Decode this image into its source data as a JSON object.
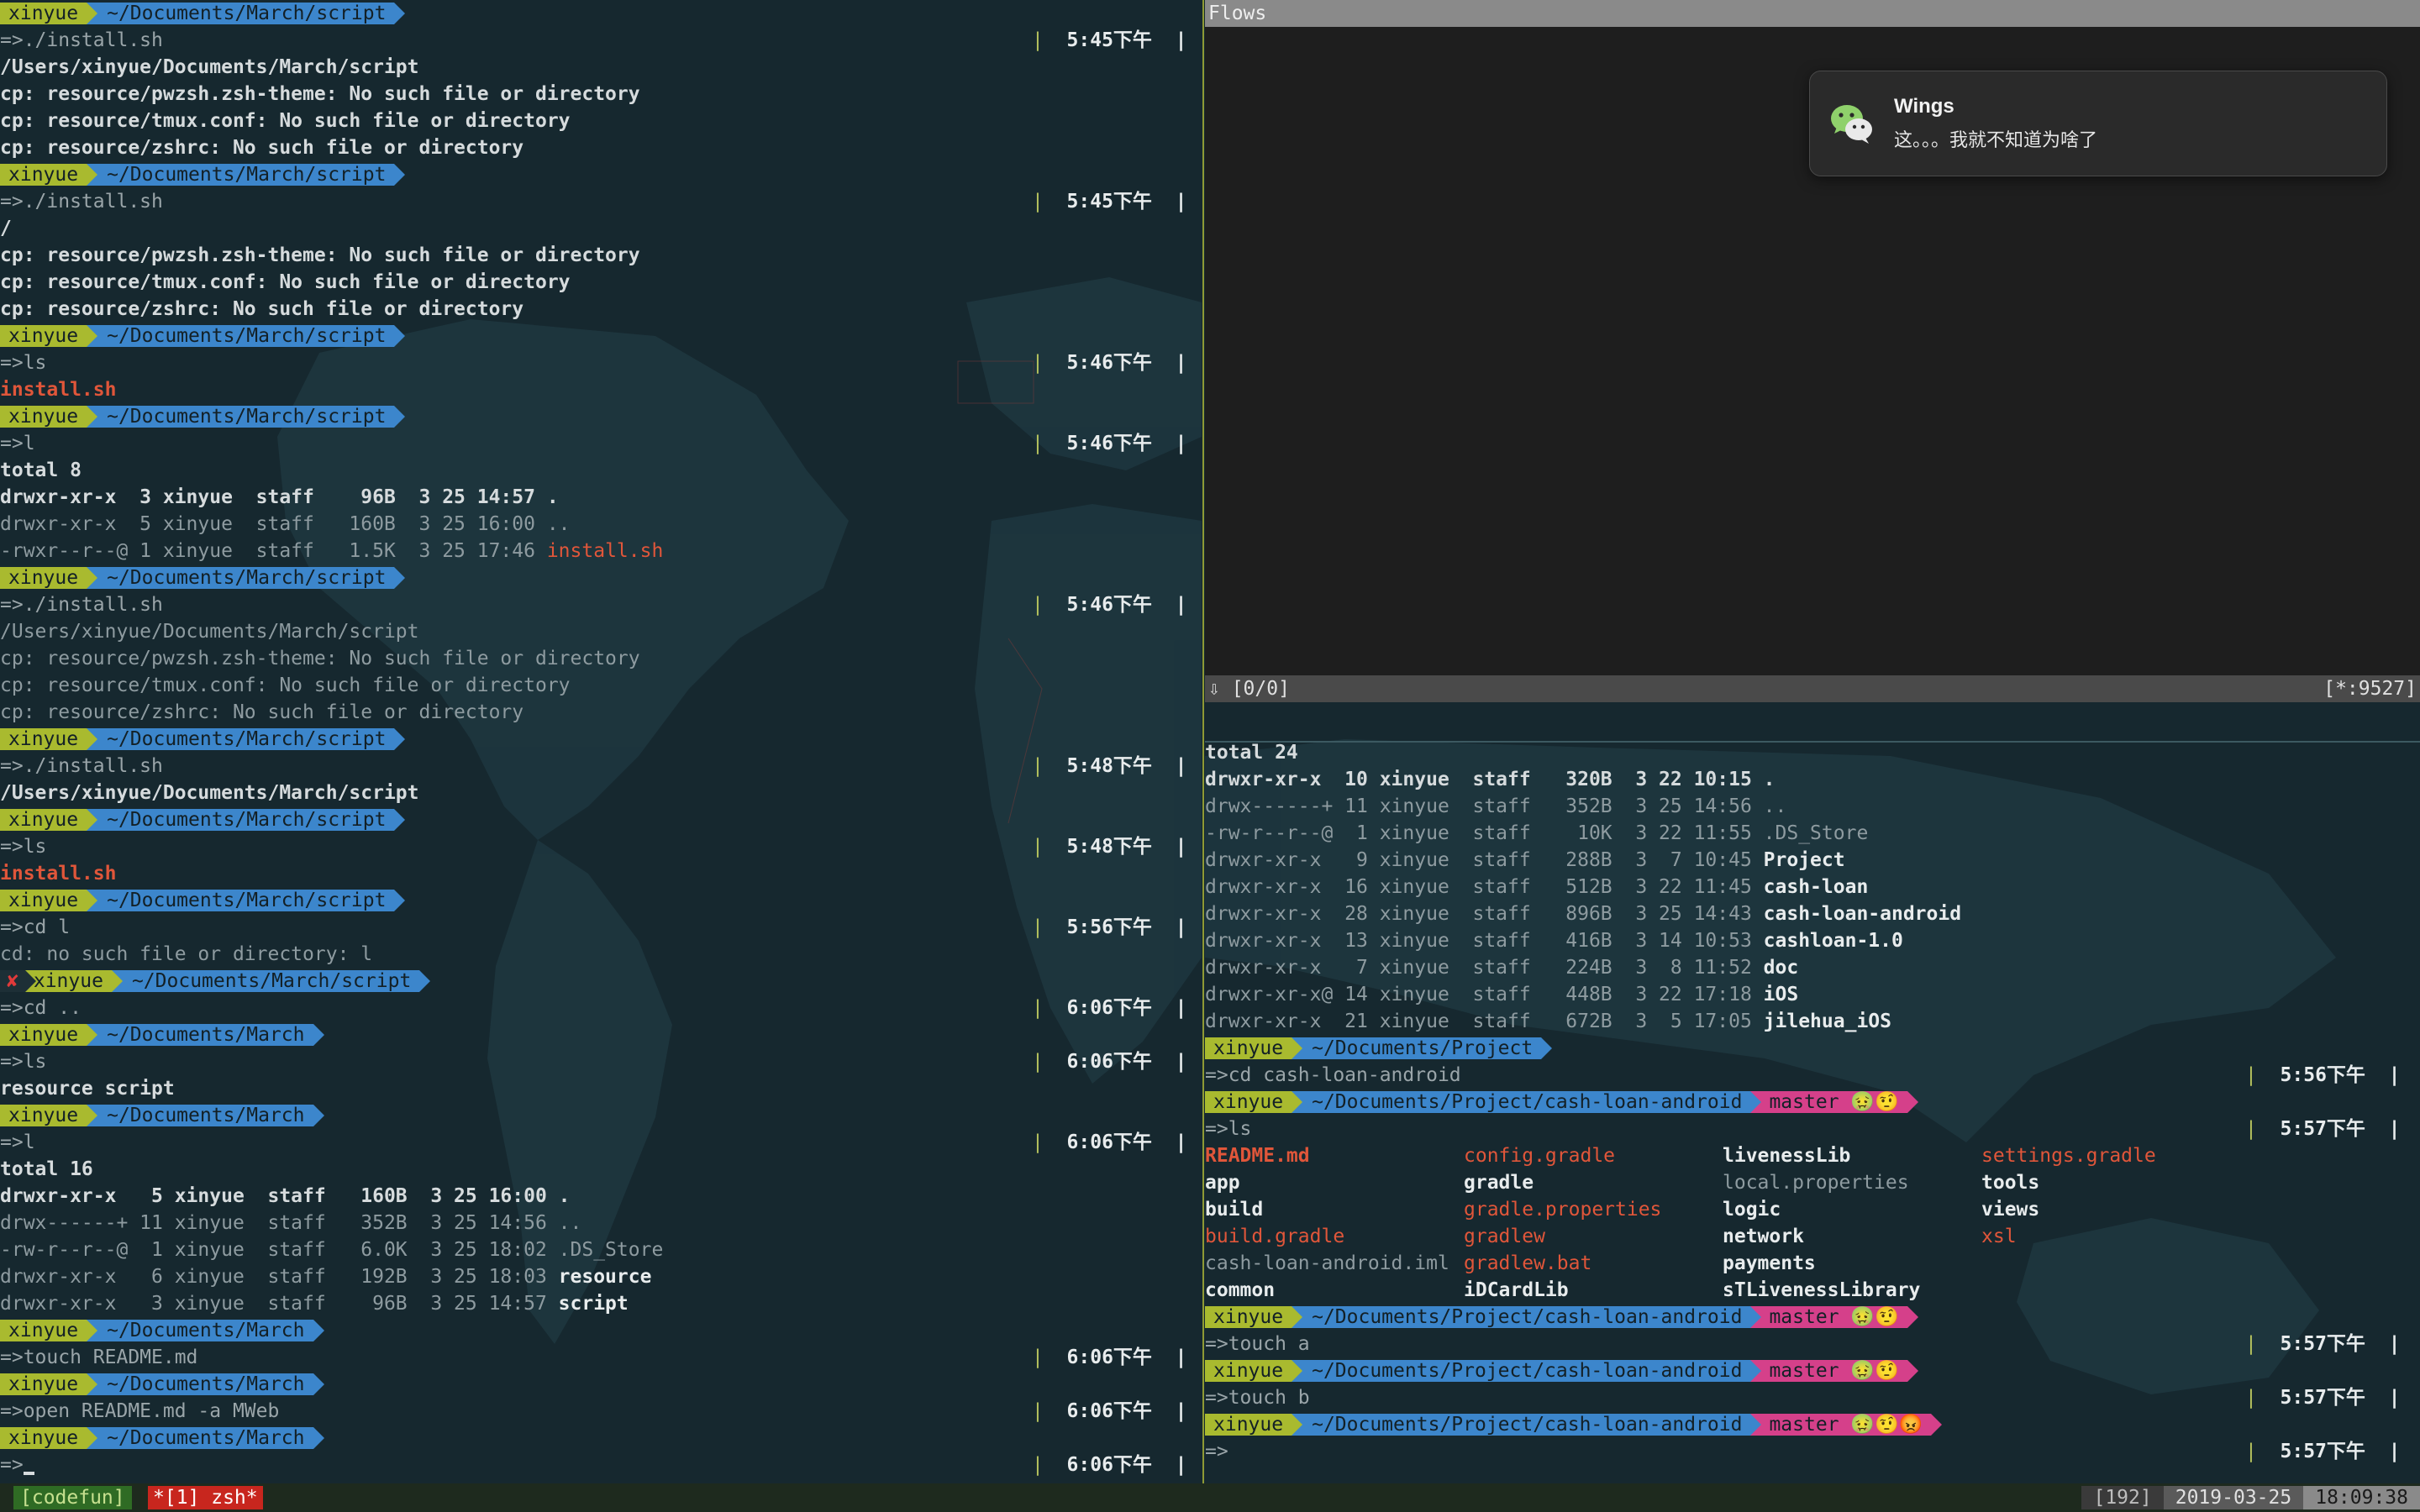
{
  "terminal_left": {
    "lines": [
      {
        "kind": "prompt",
        "user": "xinyue",
        "path": "~/Documents/March/script"
      },
      {
        "kind": "cmd",
        "text": "=>./install.sh",
        "time": "5:45下午"
      },
      {
        "kind": "out",
        "text": "/Users/xinyue/Documents/March/script",
        "style": "bold"
      },
      {
        "kind": "out",
        "text": "cp: resource/pwzsh.zsh-theme: No such file or directory",
        "style": "bold"
      },
      {
        "kind": "out",
        "text": "cp: resource/tmux.conf: No such file or directory",
        "style": "bold"
      },
      {
        "kind": "out",
        "text": "cp: resource/zshrc: No such file or directory",
        "style": "bold"
      },
      {
        "kind": "prompt",
        "user": "xinyue",
        "path": "~/Documents/March/script"
      },
      {
        "kind": "cmd",
        "text": "=>./install.sh",
        "time": "5:45下午"
      },
      {
        "kind": "out",
        "text": "/",
        "style": "bold"
      },
      {
        "kind": "out",
        "text": "cp: resource/pwzsh.zsh-theme: No such file or directory",
        "style": "bold"
      },
      {
        "kind": "out",
        "text": "cp: resource/tmux.conf: No such file or directory",
        "style": "bold"
      },
      {
        "kind": "out",
        "text": "cp: resource/zshrc: No such file or directory",
        "style": "bold"
      },
      {
        "kind": "prompt",
        "user": "xinyue",
        "path": "~/Documents/March/script"
      },
      {
        "kind": "cmd",
        "text": "=>ls",
        "time": "5:46下午"
      },
      {
        "kind": "out",
        "text": "install.sh",
        "style": "red"
      },
      {
        "kind": "prompt",
        "user": "xinyue",
        "path": "~/Documents/March/script"
      },
      {
        "kind": "cmd",
        "text": "=>l",
        "time": "5:46下午"
      },
      {
        "kind": "out",
        "text": "total 8",
        "style": "bold"
      },
      {
        "kind": "out",
        "text": "drwxr-xr-x  3 xinyue  staff    96B  3 25 14:57 .",
        "style": "bold"
      },
      {
        "kind": "out",
        "text": "drwxr-xr-x  5 xinyue  staff   160B  3 25 16:00 ..",
        "style": "dim"
      },
      {
        "kind": "ls",
        "text": "-rwxr--r--@ 1 xinyue  staff   1.5K  3 25 17:46 ",
        "name": "install.sh",
        "style": "dim",
        "namestyle": "redn"
      },
      {
        "kind": "prompt",
        "user": "xinyue",
        "path": "~/Documents/March/script"
      },
      {
        "kind": "cmd",
        "text": "=>./install.sh",
        "time": "5:46下午"
      },
      {
        "kind": "out",
        "text": "/Users/xinyue/Documents/March/script",
        "style": "dim"
      },
      {
        "kind": "out",
        "text": "cp: resource/pwzsh.zsh-theme: No such file or directory",
        "style": "dim"
      },
      {
        "kind": "out",
        "text": "cp: resource/tmux.conf: No such file or directory",
        "style": "dim"
      },
      {
        "kind": "out",
        "text": "cp: resource/zshrc: No such file or directory",
        "style": "dim"
      },
      {
        "kind": "prompt",
        "user": "xinyue",
        "path": "~/Documents/March/script"
      },
      {
        "kind": "cmd",
        "text": "=>./install.sh",
        "time": "5:48下午"
      },
      {
        "kind": "out",
        "text": "/Users/xinyue/Documents/March/script",
        "style": "bold"
      },
      {
        "kind": "prompt",
        "user": "xinyue",
        "path": "~/Documents/March/script"
      },
      {
        "kind": "cmd",
        "text": "=>ls",
        "time": "5:48下午"
      },
      {
        "kind": "out",
        "text": "install.sh",
        "style": "red"
      },
      {
        "kind": "prompt",
        "user": "xinyue",
        "path": "~/Documents/March/script"
      },
      {
        "kind": "cmd",
        "text": "=>cd l",
        "time": "5:56下午"
      },
      {
        "kind": "out",
        "text": "cd: no such file or directory: l",
        "style": "dim"
      },
      {
        "kind": "prompt",
        "err": "✘",
        "user": "xinyue",
        "path": "~/Documents/March/script"
      },
      {
        "kind": "cmd",
        "text": "=>cd ..",
        "time": "6:06下午"
      },
      {
        "kind": "prompt",
        "user": "xinyue",
        "path": "~/Documents/March"
      },
      {
        "kind": "cmd",
        "text": "=>ls",
        "time": "6:06下午"
      },
      {
        "kind": "out",
        "text": "resource script",
        "style": "bold"
      },
      {
        "kind": "prompt",
        "user": "xinyue",
        "path": "~/Documents/March"
      },
      {
        "kind": "cmd",
        "text": "=>l",
        "time": "6:06下午"
      },
      {
        "kind": "out",
        "text": "total 16",
        "style": "bold"
      },
      {
        "kind": "out",
        "text": "drwxr-xr-x   5 xinyue  staff   160B  3 25 16:00 .",
        "style": "bold"
      },
      {
        "kind": "out",
        "text": "drwx------+ 11 xinyue  staff   352B  3 25 14:56 ..",
        "style": "dim"
      },
      {
        "kind": "out",
        "text": "-rw-r--r--@  1 xinyue  staff   6.0K  3 25 18:02 .DS_Store",
        "style": "dim"
      },
      {
        "kind": "ls",
        "text": "drwxr-xr-x   6 xinyue  staff   192B  3 25 18:03 ",
        "name": "resource",
        "style": "dim",
        "namestyle": "white"
      },
      {
        "kind": "ls",
        "text": "drwxr-xr-x   3 xinyue  staff    96B  3 25 14:57 ",
        "name": "script",
        "style": "dim",
        "namestyle": "white"
      },
      {
        "kind": "prompt",
        "user": "xinyue",
        "path": "~/Documents/March"
      },
      {
        "kind": "cmd",
        "text": "=>touch README.md",
        "time": "6:06下午"
      },
      {
        "kind": "prompt",
        "user": "xinyue",
        "path": "~/Documents/March"
      },
      {
        "kind": "cmd",
        "text": "=>open README.md -a MWeb",
        "time": "6:06下午"
      },
      {
        "kind": "prompt",
        "user": "xinyue",
        "path": "~/Documents/March"
      },
      {
        "kind": "cmd",
        "text": "=>",
        "time": "6:06下午",
        "cursor": true
      }
    ]
  },
  "flows_pane": {
    "title": "Flows",
    "status_left": "⇩  [0/0]",
    "status_right": "[*:9527]"
  },
  "notification": {
    "app_icon": "wechat-icon",
    "title": "Wings",
    "body": "这。。。我就不知道为啥了"
  },
  "terminal_right": {
    "lines": [
      {
        "kind": "out",
        "text": "total 24",
        "style": "bold"
      },
      {
        "kind": "out",
        "text": "drwxr-xr-x  10 xinyue  staff   320B  3 22 10:15 .",
        "style": "bold"
      },
      {
        "kind": "out",
        "text": "drwx------+ 11 xinyue  staff   352B  3 25 14:56 ..",
        "style": "dim"
      },
      {
        "kind": "out",
        "text": "-rw-r--r--@  1 xinyue  staff    10K  3 22 11:55 .DS_Store",
        "style": "dim"
      },
      {
        "kind": "ls",
        "text": "drwxr-xr-x   9 xinyue  staff   288B  3  7 10:45 ",
        "name": "Project",
        "style": "dim",
        "namestyle": "white"
      },
      {
        "kind": "ls",
        "text": "drwxr-xr-x  16 xinyue  staff   512B  3 22 11:45 ",
        "name": "cash-loan",
        "style": "dim",
        "namestyle": "white"
      },
      {
        "kind": "ls",
        "text": "drwxr-xr-x  28 xinyue  staff   896B  3 25 14:43 ",
        "name": "cash-loan-android",
        "style": "dim",
        "namestyle": "white"
      },
      {
        "kind": "ls",
        "text": "drwxr-xr-x  13 xinyue  staff   416B  3 14 10:53 ",
        "name": "cashloan-1.0",
        "style": "dim",
        "namestyle": "white"
      },
      {
        "kind": "ls",
        "text": "drwxr-xr-x   7 xinyue  staff   224B  3  8 11:52 ",
        "name": "doc",
        "style": "dim",
        "namestyle": "white"
      },
      {
        "kind": "ls",
        "text": "drwxr-xr-x@ 14 xinyue  staff   448B  3 22 17:18 ",
        "name": "iOS",
        "style": "dim",
        "namestyle": "white"
      },
      {
        "kind": "ls",
        "text": "drwxr-xr-x  21 xinyue  staff   672B  3  5 17:05 ",
        "name": "jilehua_iOS",
        "style": "dim",
        "namestyle": "white"
      },
      {
        "kind": "prompt",
        "user": "xinyue",
        "path": "~/Documents/Project"
      },
      {
        "kind": "cmd",
        "text": "=>cd cash-loan-android",
        "time": "5:56下午"
      },
      {
        "kind": "prompt",
        "user": "xinyue",
        "path": "~/Documents/Project/cash-loan-android",
        "git": "master 🤢🤨"
      },
      {
        "kind": "cmd",
        "text": "=>ls",
        "time": "5:57下午"
      },
      {
        "kind": "grid",
        "cells": [
          [
            "README.md",
            "redb"
          ],
          [
            "config.gradle",
            "redn"
          ],
          [
            "livenessLib",
            "white"
          ],
          [
            "settings.gradle",
            "redn"
          ]
        ]
      },
      {
        "kind": "grid",
        "cells": [
          [
            "app",
            "white"
          ],
          [
            "gradle",
            "white"
          ],
          [
            "local.properties",
            "dim"
          ],
          [
            "tools",
            "white"
          ]
        ]
      },
      {
        "kind": "grid",
        "cells": [
          [
            "build",
            "white"
          ],
          [
            "gradle.properties",
            "redn"
          ],
          [
            "logic",
            "white"
          ],
          [
            "views",
            "white"
          ]
        ]
      },
      {
        "kind": "grid",
        "cells": [
          [
            "build.gradle",
            "redn"
          ],
          [
            "gradlew",
            "redn"
          ],
          [
            "network",
            "white"
          ],
          [
            "xsl",
            "redn"
          ]
        ]
      },
      {
        "kind": "grid",
        "cells": [
          [
            "cash-loan-android.iml",
            "dim"
          ],
          [
            "gradlew.bat",
            "redn"
          ],
          [
            "payments",
            "white"
          ],
          [
            "",
            ""
          ]
        ]
      },
      {
        "kind": "grid",
        "cells": [
          [
            "common",
            "white"
          ],
          [
            "iDCardLib",
            "white"
          ],
          [
            "sTLivenessLibrary",
            "white"
          ],
          [
            "",
            ""
          ]
        ]
      },
      {
        "kind": "prompt",
        "user": "xinyue",
        "path": "~/Documents/Project/cash-loan-android",
        "git": "master 🤢🤨"
      },
      {
        "kind": "cmd",
        "text": "=>touch a",
        "time": "5:57下午"
      },
      {
        "kind": "prompt",
        "user": "xinyue",
        "path": "~/Documents/Project/cash-loan-android",
        "git": "master 🤢🤨"
      },
      {
        "kind": "cmd",
        "text": "=>touch b",
        "time": "5:57下午"
      },
      {
        "kind": "prompt",
        "user": "xinyue",
        "path": "~/Documents/Project/cash-loan-android",
        "git": "master 🤢🤨😡"
      },
      {
        "kind": "cmd",
        "text": "=>",
        "time": "5:57下午"
      }
    ]
  },
  "statusbar": {
    "session": "[codefun]",
    "window": "*[1] zsh*",
    "pane": "[192]",
    "date": "2019-03-25",
    "clock": "18:09:38"
  },
  "colors": {
    "background": "#16282f",
    "user_segment": "#a9ba2f",
    "path_segment": "#3c86cc",
    "git_segment": "#d5408a",
    "error_file": "#e0563a"
  }
}
